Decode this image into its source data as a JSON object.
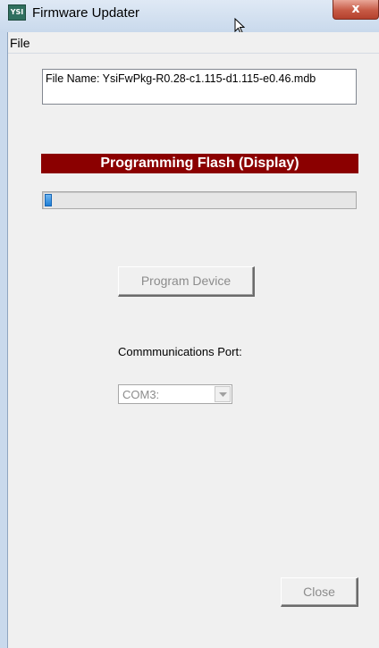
{
  "window": {
    "title": "Firmware Updater",
    "icon": "ysi-app-icon",
    "icon_text": "YSI",
    "close_glyph": "x"
  },
  "menu": {
    "file_label": "File"
  },
  "file_name": "File Name: YsiFwPkg-R0.28-c1.115-d1.115-e0.46.mdb",
  "status": {
    "text": "Programming Flash (Display)",
    "color": "#8b0000"
  },
  "progress": {
    "fraction": 0.02
  },
  "buttons": {
    "program_device": "Program Device",
    "close": "Close"
  },
  "port": {
    "label": "Commmunications Port:",
    "selected": "COM3:"
  }
}
